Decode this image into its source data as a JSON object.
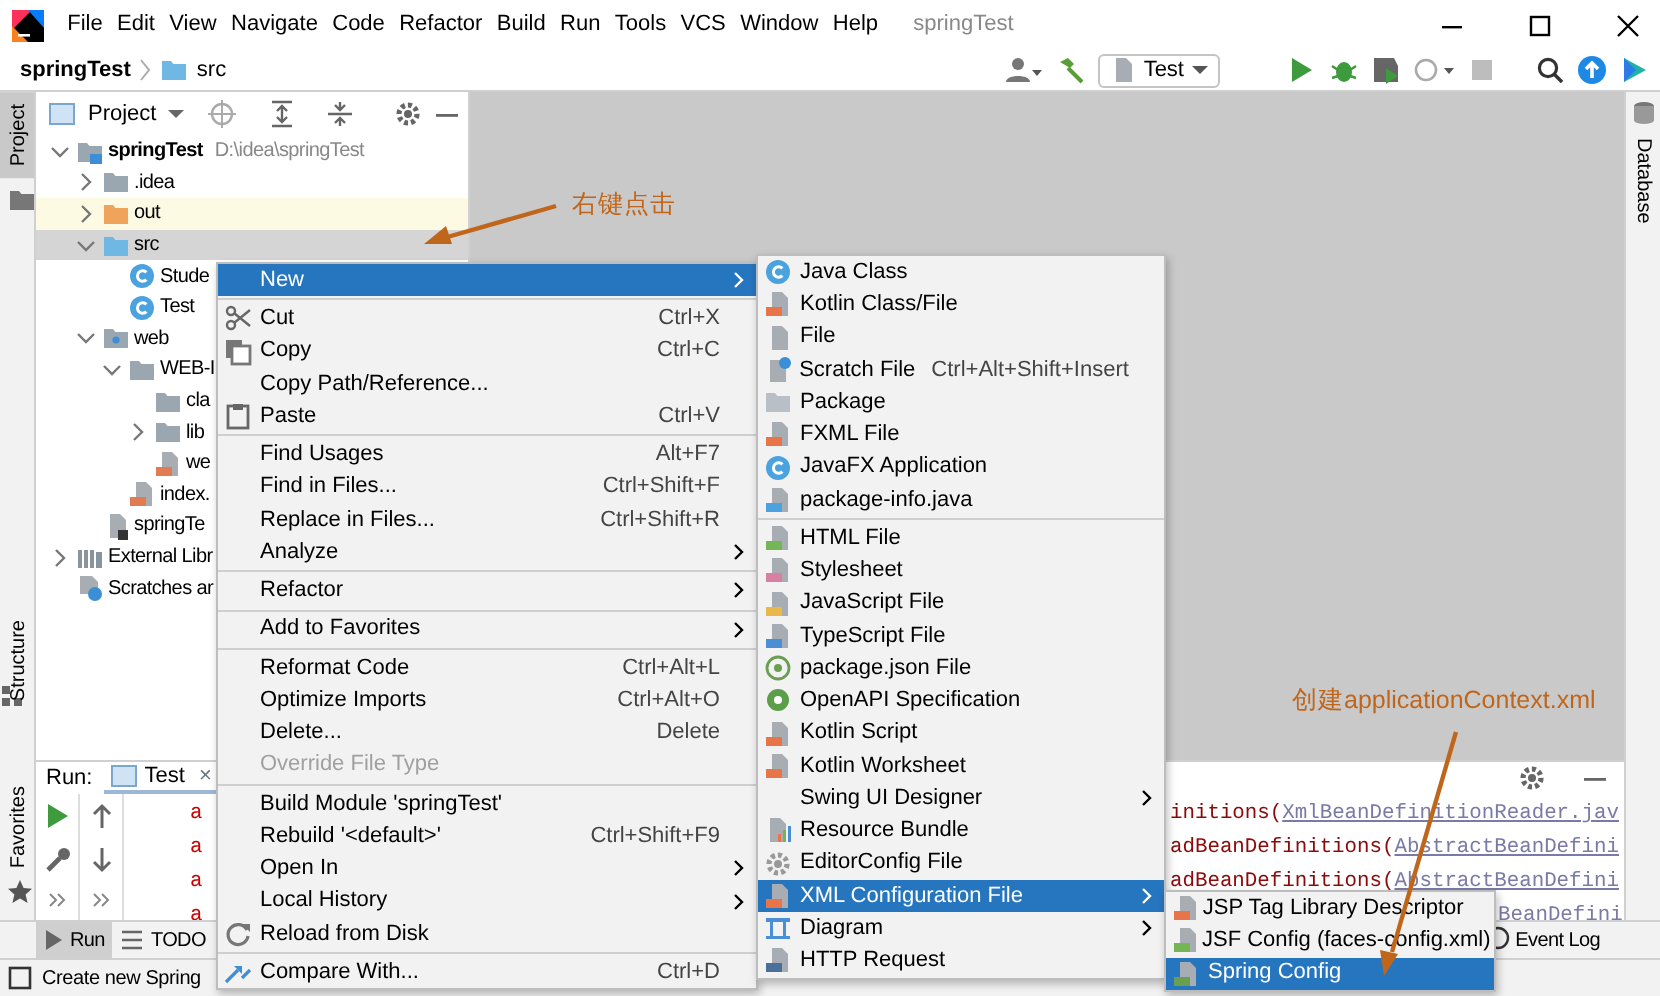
{
  "menu_bar": {
    "items": [
      "File",
      "Edit",
      "View",
      "Navigate",
      "Code",
      "Refactor",
      "Build",
      "Run",
      "Tools",
      "VCS",
      "Window",
      "Help"
    ],
    "title": "springTest"
  },
  "nav_bar": {
    "breadcrumbs": [
      "springTest",
      "src"
    ],
    "run_config": "Test"
  },
  "left_strip": {
    "tabs": [
      {
        "label": "Project",
        "selected": true
      },
      {
        "label": "Structure",
        "selected": false
      },
      {
        "label": "Favorites",
        "selected": false
      }
    ]
  },
  "right_strip": {
    "tabs": [
      {
        "label": "Database"
      }
    ]
  },
  "project_panel": {
    "title": "Project",
    "tree": [
      {
        "kind": "module",
        "label": "springTest",
        "path": "D:\\idea\\springTest",
        "expanded": true,
        "selected": false,
        "children": [
          {
            "kind": "folder",
            "label": ".idea",
            "expanded": false,
            "selected": false,
            "excluded": false
          },
          {
            "kind": "folder",
            "label": "out",
            "expanded": false,
            "selected": false,
            "excluded": true
          },
          {
            "kind": "source",
            "label": "src",
            "expanded": true,
            "selected": true,
            "excluded": false,
            "children": [
              {
                "kind": "class",
                "label": "Stude",
                "selected": false
              },
              {
                "kind": "class",
                "label": "Test",
                "selected": false
              }
            ]
          },
          {
            "kind": "web",
            "label": "web",
            "expanded": true,
            "selected": false,
            "excluded": false,
            "children": [
              {
                "kind": "folder",
                "label": "WEB-I",
                "expanded": true,
                "selected": false,
                "children": [
                  {
                    "kind": "folder",
                    "label": "cla",
                    "selected": false
                  },
                  {
                    "kind": "folder",
                    "label": "lib",
                    "expanded": false,
                    "selected": false
                  },
                  {
                    "kind": "xml",
                    "label": "we",
                    "selected": false
                  }
                ]
              },
              {
                "kind": "jsp",
                "label": "index.",
                "selected": false
              }
            ]
          },
          {
            "kind": "iml",
            "label": "springTe",
            "selected": false
          }
        ]
      },
      {
        "kind": "libraries",
        "label": "External Libr",
        "expanded": false,
        "selected": false
      },
      {
        "kind": "scratches",
        "label": "Scratches ar",
        "selected": false
      }
    ]
  },
  "run_panel": {
    "label": "Run:",
    "tab": "Test",
    "close": "×",
    "console": [
      {
        "prefix": "a",
        "method": "initions(",
        "link": "XmlBeanDefinitionReader.jav"
      },
      {
        "prefix": "a",
        "method": "adBeanDefinitions(",
        "link": "AbstractBeanDefini"
      },
      {
        "prefix": "a",
        "method": "adBeanDefinitions(",
        "link": "AbstractBeanDefini"
      },
      {
        "prefix": "a",
        "link": "BeanDefini"
      }
    ]
  },
  "tool_tabs": [
    {
      "label": "Run",
      "selected": true
    },
    {
      "label": "TODO",
      "selected": false
    }
  ],
  "event_log": "Event Log",
  "status_bar": {
    "text": "Create new Spring"
  },
  "context_menu": {
    "items": [
      {
        "kind": "item",
        "label": "New",
        "submenu": true,
        "selected": true,
        "disabled": false
      },
      {
        "kind": "separator"
      },
      {
        "kind": "item",
        "label": "Cut",
        "shortcut": "Ctrl+X",
        "submenu": false,
        "selected": false,
        "disabled": false
      },
      {
        "kind": "item",
        "label": "Copy",
        "shortcut": "Ctrl+C",
        "submenu": false,
        "selected": false,
        "disabled": false
      },
      {
        "kind": "item",
        "label": "Copy Path/Reference...",
        "submenu": false,
        "selected": false,
        "disabled": false
      },
      {
        "kind": "item",
        "label": "Paste",
        "shortcut": "Ctrl+V",
        "submenu": false,
        "selected": false,
        "disabled": false
      },
      {
        "kind": "separator"
      },
      {
        "kind": "item",
        "label": "Find Usages",
        "shortcut": "Alt+F7",
        "submenu": false,
        "selected": false,
        "disabled": false
      },
      {
        "kind": "item",
        "label": "Find in Files...",
        "shortcut": "Ctrl+Shift+F",
        "submenu": false,
        "selected": false,
        "disabled": false
      },
      {
        "kind": "item",
        "label": "Replace in Files...",
        "shortcut": "Ctrl+Shift+R",
        "submenu": false,
        "selected": false,
        "disabled": false
      },
      {
        "kind": "item",
        "label": "Analyze",
        "submenu": true,
        "selected": false,
        "disabled": false
      },
      {
        "kind": "separator"
      },
      {
        "kind": "item",
        "label": "Refactor",
        "submenu": true,
        "selected": false,
        "disabled": false
      },
      {
        "kind": "separator"
      },
      {
        "kind": "item",
        "label": "Add to Favorites",
        "submenu": true,
        "selected": false,
        "disabled": false
      },
      {
        "kind": "separator"
      },
      {
        "kind": "item",
        "label": "Reformat Code",
        "shortcut": "Ctrl+Alt+L",
        "submenu": false,
        "selected": false,
        "disabled": false
      },
      {
        "kind": "item",
        "label": "Optimize Imports",
        "shortcut": "Ctrl+Alt+O",
        "submenu": false,
        "selected": false,
        "disabled": false
      },
      {
        "kind": "item",
        "label": "Delete...",
        "shortcut": "Delete",
        "submenu": false,
        "selected": false,
        "disabled": false
      },
      {
        "kind": "item",
        "label": "Override File Type",
        "submenu": false,
        "selected": false,
        "disabled": true
      },
      {
        "kind": "separator"
      },
      {
        "kind": "item",
        "label": "Build Module 'springTest'",
        "submenu": false,
        "selected": false,
        "disabled": false
      },
      {
        "kind": "item",
        "label": "Rebuild '<default>'",
        "shortcut": "Ctrl+Shift+F9",
        "submenu": false,
        "selected": false,
        "disabled": false
      },
      {
        "kind": "item",
        "label": "Open In",
        "submenu": true,
        "selected": false,
        "disabled": false
      },
      {
        "kind": "item",
        "label": "Local History",
        "submenu": true,
        "selected": false,
        "disabled": false
      },
      {
        "kind": "item",
        "label": "Reload from Disk",
        "submenu": false,
        "selected": false,
        "disabled": false
      },
      {
        "kind": "separator"
      },
      {
        "kind": "item",
        "label": "Compare With...",
        "shortcut": "Ctrl+D",
        "submenu": false,
        "selected": false,
        "disabled": false
      }
    ]
  },
  "new_submenu": {
    "items": [
      {
        "kind": "item",
        "label": "Java Class",
        "submenu": false,
        "selected": false
      },
      {
        "kind": "item",
        "label": "Kotlin Class/File",
        "submenu": false,
        "selected": false
      },
      {
        "kind": "item",
        "label": "File",
        "submenu": false,
        "selected": false
      },
      {
        "kind": "item",
        "label": "Scratch File",
        "shortcut": "Ctrl+Alt+Shift+Insert",
        "submenu": false,
        "selected": false
      },
      {
        "kind": "item",
        "label": "Package",
        "submenu": false,
        "selected": false
      },
      {
        "kind": "item",
        "label": "FXML File",
        "submenu": false,
        "selected": false
      },
      {
        "kind": "item",
        "label": "JavaFX Application",
        "submenu": false,
        "selected": false
      },
      {
        "kind": "item",
        "label": "package-info.java",
        "submenu": false,
        "selected": false
      },
      {
        "kind": "separator"
      },
      {
        "kind": "item",
        "label": "HTML File",
        "submenu": false,
        "selected": false
      },
      {
        "kind": "item",
        "label": "Stylesheet",
        "submenu": false,
        "selected": false
      },
      {
        "kind": "item",
        "label": "JavaScript File",
        "submenu": false,
        "selected": false
      },
      {
        "kind": "item",
        "label": "TypeScript File",
        "submenu": false,
        "selected": false
      },
      {
        "kind": "item",
        "label": "package.json File",
        "submenu": false,
        "selected": false
      },
      {
        "kind": "item",
        "label": "OpenAPI Specification",
        "submenu": false,
        "selected": false
      },
      {
        "kind": "item",
        "label": "Kotlin Script",
        "submenu": false,
        "selected": false
      },
      {
        "kind": "item",
        "label": "Kotlin Worksheet",
        "submenu": false,
        "selected": false
      },
      {
        "kind": "item",
        "label": "Swing UI Designer",
        "submenu": true,
        "selected": false
      },
      {
        "kind": "item",
        "label": "Resource Bundle",
        "submenu": false,
        "selected": false
      },
      {
        "kind": "item",
        "label": "EditorConfig File",
        "submenu": false,
        "selected": false
      },
      {
        "kind": "item",
        "label": "XML Configuration File",
        "submenu": true,
        "selected": true
      },
      {
        "kind": "item",
        "label": "Diagram",
        "submenu": true,
        "selected": false
      },
      {
        "kind": "item",
        "label": "HTTP Request",
        "submenu": false,
        "selected": false
      }
    ]
  },
  "xml_submenu": {
    "items": [
      {
        "kind": "item",
        "label": "JSP Tag Library Descriptor",
        "submenu": false,
        "selected": false
      },
      {
        "kind": "item",
        "label": "JSF Config (faces-config.xml)",
        "submenu": false,
        "selected": false
      },
      {
        "kind": "item",
        "label": "Spring Config",
        "submenu": false,
        "selected": true
      }
    ]
  },
  "annotations": [
    {
      "text": "右键点击"
    },
    {
      "text": "创建applicationContext.xml"
    }
  ]
}
